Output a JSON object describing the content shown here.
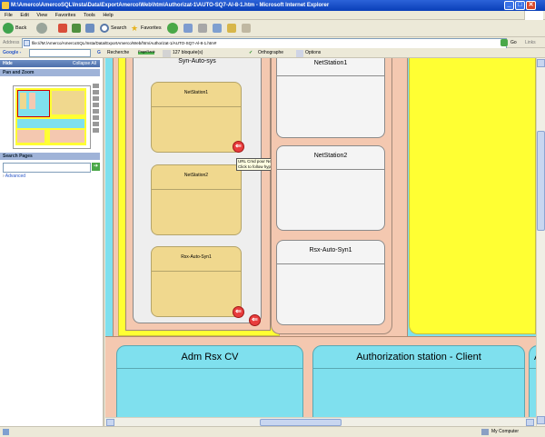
{
  "window": {
    "title": "M:\\Amerco\\AmercoSQL\\Insta\\Data\\ExportAmerco\\Web\\htm\\Authorizat-1\\AUTO-SQ7-Al-8-1.htm - Microsoft Internet Explorer",
    "buttons": [
      "_",
      "□",
      "✕"
    ]
  },
  "menu": [
    "File",
    "Edit",
    "View",
    "Favorites",
    "Tools",
    "Help"
  ],
  "toolbar": {
    "back": "Back",
    "search": "Search",
    "favorites": "Favorites"
  },
  "address": {
    "label": "Address",
    "value": "file:///M:/Amerco/AmercoSQL/Insta/Data/ExportAmerco/Web/htm/Authorizat-1/AUTO-SQ7-Al-8-1.htm#",
    "go": "Go",
    "links": "Links"
  },
  "googlebar": {
    "brand": "Google -",
    "search": "Recherche",
    "pagerank": "PageRank",
    "blocked": "127 bloquée(s)",
    "spell": "Orthographe",
    "options": "Options"
  },
  "sidebar": {
    "hide": "Hide",
    "collapse": "Collapse All",
    "pan_zoom": "Pan and Zoom",
    "search_pages": "Search Pages",
    "advanced": "Advanced"
  },
  "diagram": {
    "syn_auto_sys": "Syn-Auto-sys",
    "netstation1": "NetStation1",
    "netstation2": "NetStation2",
    "rsx_auto_syn1": "Rsx-Auto-Syn1",
    "right_netstation1": "NetStation1",
    "right_netstation2": "NetStation2",
    "right_rsx": "Rsx-Auto-Syn1",
    "tooltip_line1": "URL Cmd pour NetStation1",
    "tooltip_line2": "Click to follow hyperlink.",
    "adm_rsx_cv": "Adm Rsx CV",
    "auth_client": "Authorization station - Client",
    "auth_partial": "A"
  },
  "status": {
    "zone": "My Computer"
  }
}
